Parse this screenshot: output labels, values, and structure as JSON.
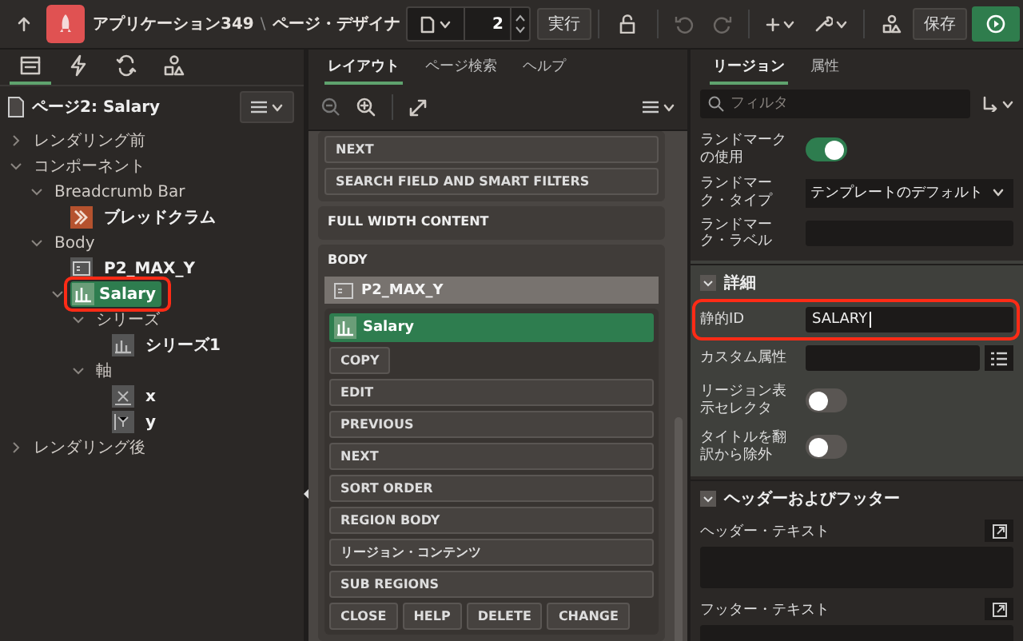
{
  "top_bar": {
    "app_name": "アプリケーション349",
    "separator": "\\",
    "page_title": "ページ・デザイナ",
    "page_number": "2",
    "run_label": "実行",
    "save_label": "保存"
  },
  "left_panel": {
    "tabs": [
      {
        "kind": "tree",
        "selected": true
      },
      {
        "kind": "bolt",
        "selected": false
      },
      {
        "kind": "cycle",
        "selected": false
      },
      {
        "kind": "shapes",
        "selected": false
      }
    ],
    "page_label": "ページ2: Salary",
    "tree": [
      {
        "label": "レンダリング前",
        "expanded": false,
        "selected": false
      },
      {
        "label": "コンポーネント",
        "expanded": true,
        "selected": false,
        "children": [
          {
            "label": "Breadcrumb Bar",
            "expanded": true,
            "selected": false,
            "children": [
              {
                "label": "ブレッドクラム",
                "kind": "breadcrumb",
                "selected": false
              }
            ]
          },
          {
            "label": "Body",
            "expanded": true,
            "selected": false,
            "children": [
              {
                "label": "P2_MAX_Y",
                "kind": "item",
                "selected": false
              },
              {
                "label": "Salary",
                "kind": "chart",
                "expanded": true,
                "selected": true,
                "highlighted": true,
                "children": [
                  {
                    "label": "シリーズ",
                    "expanded": true,
                    "selected": false,
                    "children": [
                      {
                        "label": "シリーズ1",
                        "kind": "series",
                        "selected": false
                      }
                    ]
                  },
                  {
                    "label": "軸",
                    "expanded": true,
                    "selected": false,
                    "children": [
                      {
                        "label": "x",
                        "kind": "axis-x",
                        "selected": false
                      },
                      {
                        "label": "y",
                        "kind": "axis-y",
                        "selected": false
                      }
                    ]
                  }
                ]
              }
            ]
          }
        ]
      },
      {
        "label": "レンダリング後",
        "expanded": false,
        "selected": false
      }
    ]
  },
  "layout_panel": {
    "tabs": [
      {
        "label": "レイアウト",
        "selected": true
      },
      {
        "label": "ページ検索",
        "selected": false
      },
      {
        "label": "ヘルプ",
        "selected": false
      }
    ],
    "top_slots": [
      "NEXT",
      "SEARCH FIELD AND SMART FILTERS"
    ],
    "full_width_title": "FULL WIDTH CONTENT",
    "body_title": "BODY",
    "body_item": "P2_MAX_Y",
    "region": {
      "label": "Salary",
      "selected": true,
      "slots": [
        {
          "label": "COPY",
          "kind": "short"
        },
        {
          "label": "EDIT",
          "kind": "wide"
        },
        {
          "label": "PREVIOUS",
          "kind": "wide"
        },
        {
          "label": "NEXT",
          "kind": "wide"
        },
        {
          "label": "SORT ORDER",
          "kind": "wide"
        },
        {
          "label": "REGION BODY",
          "kind": "wide"
        },
        {
          "label": "リージョン・コンテンツ",
          "kind": "wide"
        },
        {
          "label": "SUB REGIONS",
          "kind": "wide"
        },
        {
          "label": "CLOSE",
          "kind": "short"
        },
        {
          "label": "HELP",
          "kind": "short"
        },
        {
          "label": "DELETE",
          "kind": "short"
        },
        {
          "label": "CHANGE",
          "kind": "short"
        }
      ]
    }
  },
  "property_panel": {
    "tabs": [
      {
        "label": "リージョン",
        "selected": true
      },
      {
        "label": "属性",
        "selected": false
      }
    ],
    "filter": {
      "placeholder": "フィルタ"
    },
    "groups": [
      {
        "rows": [
          {
            "kind": "toggle",
            "label": "ランドマークの使用",
            "on": true
          },
          {
            "kind": "select",
            "label": "ランドマーク・タイプ",
            "value": "テンプレートのデフォルト"
          },
          {
            "kind": "text",
            "label": "ランドマーク・ラベル"
          }
        ]
      },
      {
        "title": "詳細",
        "expanded": true,
        "current": true,
        "rows": [
          {
            "kind": "text",
            "label": "静的ID",
            "value": "SALARY",
            "highlighted": true
          },
          {
            "kind": "text-list",
            "label": "カスタム属性"
          },
          {
            "kind": "toggle",
            "label": "リージョン表示セレクタ",
            "on": false
          },
          {
            "kind": "toggle",
            "label": "タイトルを翻訳から除外",
            "on": false
          }
        ]
      },
      {
        "title": "ヘッダーおよびフッター",
        "expanded": true,
        "rows": [
          {
            "kind": "textarea",
            "label": "ヘッダー・テキスト"
          },
          {
            "kind": "textarea",
            "label": "フッター・テキスト"
          }
        ]
      }
    ]
  }
}
